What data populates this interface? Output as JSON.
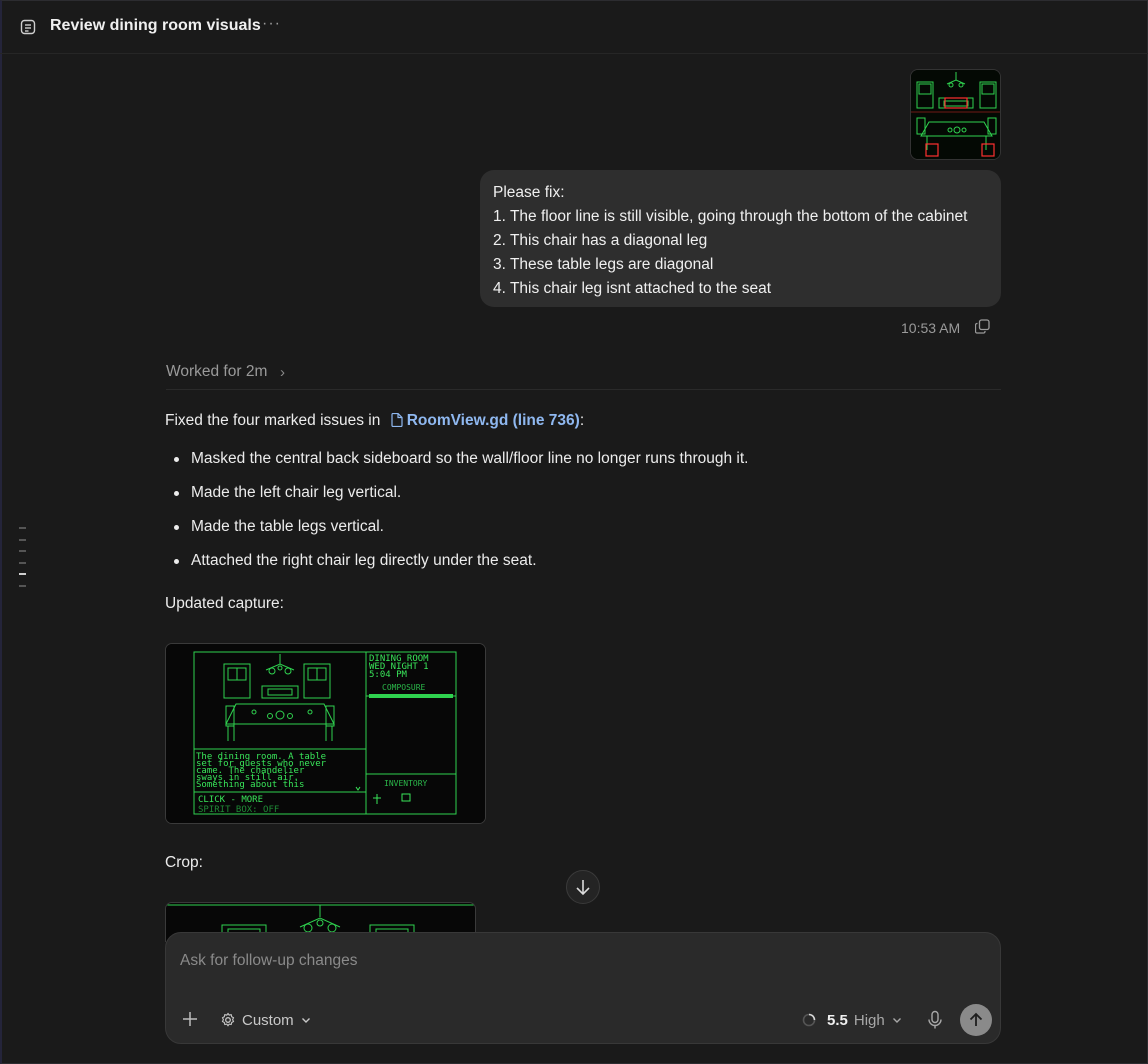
{
  "header": {
    "title": "Review dining room visuals",
    "more_icon": "ellipsis-icon"
  },
  "user_message": {
    "lines": [
      "Please fix:",
      "1. The floor line is still visible, going through the bottom of the cabinet",
      "2. This chair has a diagonal leg",
      "3. These table legs are diagonal",
      "4. This chair leg isnt attached to the seat"
    ],
    "timestamp": "10:53 AM"
  },
  "worked": {
    "label": "Worked for 2m"
  },
  "response": {
    "intro": "Fixed the four marked issues in",
    "file_link": "RoomView.gd (line 736)",
    "intro_suffix": ":",
    "bullets": [
      "Masked the central back sideboard so the wall/floor line no longer runs through it.",
      "Made the left chair leg vertical.",
      "Made the table legs vertical.",
      "Attached the right chair leg directly under the seat."
    ],
    "updated_label": "Updated capture:",
    "crop_label": "Crop:"
  },
  "capture": {
    "hud_lines": [
      "DINING ROOM",
      "WED NIGHT 1",
      "5:04 PM"
    ],
    "composure_label": "COMPOSURE",
    "narrative_lines": [
      "The dining room. A table",
      "set for guests who never",
      "came. The chandelier",
      "sways in still air.",
      "Something about this"
    ],
    "click_more": "CLICK - MORE",
    "spirit_box": "SPIRIT BOX: OFF",
    "inventory_label": "INVENTORY"
  },
  "composer": {
    "placeholder": "Ask for follow-up changes",
    "mode": "Custom",
    "model_version": "5.5",
    "effort": "High"
  },
  "colors": {
    "accent_link": "#8fb8f0",
    "terminal_green": "#39e65a",
    "background": "#1a1a1a"
  }
}
